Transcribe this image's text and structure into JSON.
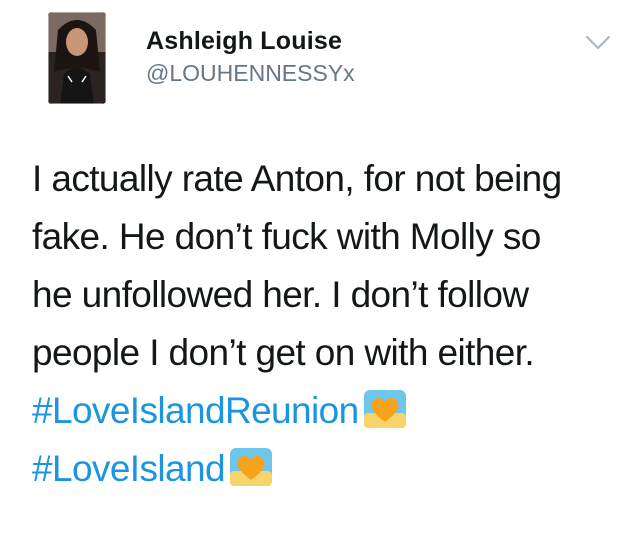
{
  "author": {
    "display_name": "Ashleigh Louise",
    "handle": "@LOUHENNESSYx",
    "avatar_icon": "profile-photo"
  },
  "menu": {
    "icon": "chevron-down-icon"
  },
  "tweet": {
    "lines": [
      "I actually rate Anton, for not being",
      "fake. He don’t fuck with Molly so",
      "he unfollowed her. I don’t follow",
      "people I don’t get on with either."
    ],
    "hashtags": [
      {
        "text": "#LoveIslandReunion",
        "emoji": "sunrise-heart-icon"
      },
      {
        "text": "#LoveIsland",
        "emoji": "sunrise-heart-icon"
      }
    ]
  },
  "colors": {
    "text": "#14171a",
    "secondary": "#657786",
    "link": "#1b95e0",
    "background": "#ffffff"
  }
}
